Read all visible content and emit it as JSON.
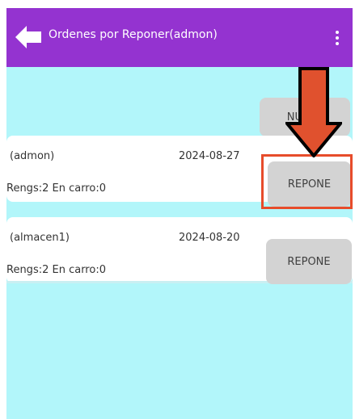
{
  "colors": {
    "appbar": "#9433d0",
    "background": "#b2f6fa",
    "card": "#ffffff",
    "button": "#d3d3d3",
    "highlight": "#e74c2b",
    "arrow_fill": "#e0512e"
  },
  "appbar": {
    "back_icon": "back-arrow-icon",
    "title": "Ordenes por Reponer(admon)",
    "menu_icon": "more-vert-icon"
  },
  "new_button": {
    "label": "NUEVA"
  },
  "orders": [
    {
      "user": "(admon)",
      "date": "2024-08-27",
      "info": "Rengs:2 En carro:0",
      "action": "REPONE"
    },
    {
      "user": "(almacen1)",
      "date": "2024-08-20",
      "info": "Rengs:2 En carro:0",
      "action": "REPONE"
    }
  ],
  "annotation": {
    "arrow_icon": "down-arrow-icon"
  }
}
